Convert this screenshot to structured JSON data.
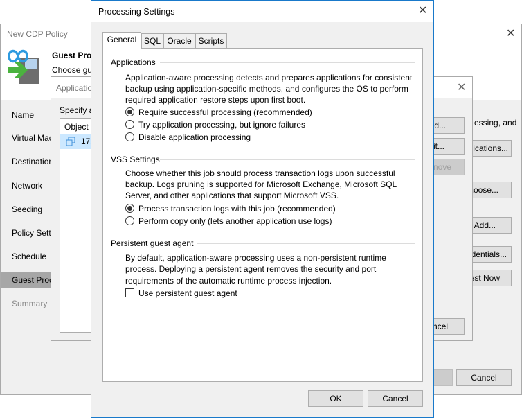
{
  "back_window": {
    "title": "New CDP Policy",
    "header_title": "Guest Proc",
    "header_subtitle": "Choose gu",
    "nav": [
      {
        "label": "Name"
      },
      {
        "label": "Virtual Mac"
      },
      {
        "label": "Destination"
      },
      {
        "label": "Network"
      },
      {
        "label": "Seeding"
      },
      {
        "label": "Policy Setti"
      },
      {
        "label": "Schedule"
      },
      {
        "label": "Guest Proc",
        "selected": true
      },
      {
        "label": "Summary",
        "disabled": true
      }
    ],
    "right_text": "essing, and",
    "right_buttons": [
      "plications...",
      "hoose...",
      "Add...",
      "dentials...",
      "est Now"
    ],
    "cancel_label": "Cancel"
  },
  "app_window": {
    "title": "Applicatio",
    "specify_label": "Specify a",
    "column_header": "Object",
    "rows": [
      {
        "label": "172"
      }
    ],
    "buttons": [
      "dd...",
      "lit...",
      "nove"
    ],
    "cancel_label": "ncel"
  },
  "dialog": {
    "title": "Processing Settings",
    "tabs": [
      "General",
      "SQL",
      "Oracle",
      "Scripts"
    ],
    "applications": {
      "heading": "Applications",
      "description": [
        "Application-aware processing detects and prepares applications for consistent",
        "backup using application-specific methods, and configures the OS to perform",
        "required application restore steps upon first boot."
      ],
      "options": [
        "Require successful processing (recommended)",
        "Try application processing, but ignore failures",
        "Disable application processing"
      ],
      "selected": 0
    },
    "vss": {
      "heading": "VSS Settings",
      "description": [
        "Choose whether this job should process transaction logs upon successful",
        "backup. Logs pruning is supported for Microsoft Exchange, Microsoft SQL",
        "Server, and other applications that support Microsoft VSS."
      ],
      "options": [
        "Process transaction logs with this job (recommended)",
        "Perform copy only (lets another application use logs)"
      ],
      "selected": 0
    },
    "agent": {
      "heading": "Persistent guest agent",
      "description": [
        "By default, application-aware processing uses a non-persistent runtime",
        "process. Deploying a persistent agent removes the security and port",
        "requirements of the automatic runtime process injection."
      ],
      "checkbox_label": "Use persistent guest agent",
      "checked": false
    },
    "ok_label": "OK",
    "cancel_label": "Cancel"
  },
  "colors": {
    "accent": "#1979ca",
    "selected_row": "#cce8ff",
    "nav_selected": "#a6a6a6"
  }
}
